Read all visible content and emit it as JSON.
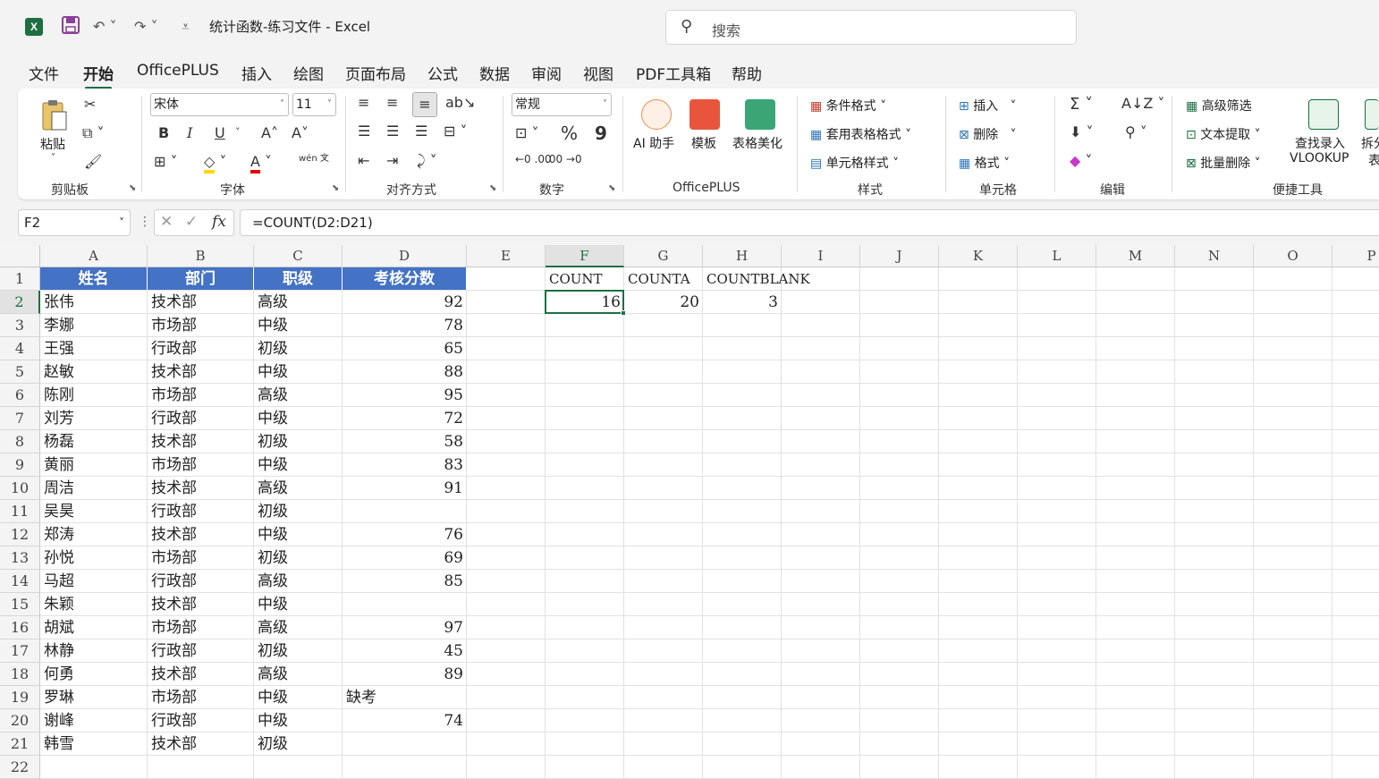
{
  "window": {
    "title": "统计函数-练习文件 - Excel",
    "app_icon": "X"
  },
  "search": {
    "placeholder": "搜索"
  },
  "tabs": [
    "文件",
    "开始",
    "OfficePLUS",
    "插入",
    "绘图",
    "页面布局",
    "公式",
    "数据",
    "审阅",
    "视图",
    "PDF工具箱",
    "帮助"
  ],
  "active_tab": "开始",
  "ribbon": {
    "clipboard": {
      "paste": "粘贴",
      "label": "剪贴板"
    },
    "font": {
      "name": "宋体",
      "size": "11",
      "label": "字体",
      "bold": "B",
      "italic": "I",
      "underline": "U",
      "phonetic": "wén 文"
    },
    "alignment": {
      "label": "对齐方式"
    },
    "number": {
      "format": "常规",
      "label": "数字",
      "percent": "%",
      "comma": "9"
    },
    "officeplus": {
      "ai": "AI 助手",
      "template": "模板",
      "beautify": "表格美化",
      "label": "OfficePLUS"
    },
    "styles": {
      "conditional": "条件格式",
      "table_format": "套用表格格式",
      "cell_styles": "单元格样式",
      "label": "样式"
    },
    "cells": {
      "insert": "插入",
      "delete": "删除",
      "format": "格式",
      "label": "单元格"
    },
    "editing": {
      "label": "编辑"
    },
    "tools": {
      "adv_filter": "高级筛选",
      "text_extract": "文本提取",
      "batch_delete": "批量删除",
      "lookup_line1": "查找录入",
      "lookup_line2": "VLOOKUP",
      "split_line1": "拆分",
      "split_line2": "表",
      "label": "便捷工具"
    }
  },
  "formula_bar": {
    "name_box": "F2",
    "formula": "=COUNT(D2:D21)",
    "fx": "fx"
  },
  "columns": [
    "A",
    "B",
    "C",
    "D",
    "E",
    "F",
    "G",
    "H",
    "I",
    "J",
    "K",
    "L",
    "M",
    "N",
    "O",
    "P"
  ],
  "rows": [
    "1",
    "2",
    "3",
    "4",
    "5",
    "6",
    "7",
    "8",
    "9",
    "10",
    "11",
    "12",
    "13",
    "14",
    "15",
    "16",
    "17",
    "18",
    "19",
    "20",
    "21",
    "22"
  ],
  "selected_cell": "F2",
  "sheet": {
    "header": [
      "姓名",
      "部门",
      "职级",
      "考核分数"
    ],
    "records": [
      [
        "张伟",
        "技术部",
        "高级",
        "92"
      ],
      [
        "李娜",
        "市场部",
        "中级",
        "78"
      ],
      [
        "王强",
        "行政部",
        "初级",
        "65"
      ],
      [
        "赵敏",
        "技术部",
        "中级",
        "88"
      ],
      [
        "陈刚",
        "市场部",
        "高级",
        "95"
      ],
      [
        "刘芳",
        "行政部",
        "中级",
        "72"
      ],
      [
        "杨磊",
        "技术部",
        "初级",
        "58"
      ],
      [
        "黄丽",
        "市场部",
        "中级",
        "83"
      ],
      [
        "周洁",
        "技术部",
        "高级",
        "91"
      ],
      [
        "吴昊",
        "行政部",
        "初级",
        ""
      ],
      [
        "郑涛",
        "技术部",
        "中级",
        "76"
      ],
      [
        "孙悦",
        "市场部",
        "初级",
        "69"
      ],
      [
        "马超",
        "行政部",
        "高级",
        "85"
      ],
      [
        "朱颖",
        "技术部",
        "中级",
        ""
      ],
      [
        "胡斌",
        "市场部",
        "高级",
        "97"
      ],
      [
        "林静",
        "行政部",
        "初级",
        "45"
      ],
      [
        "何勇",
        "技术部",
        "高级",
        "89"
      ],
      [
        "罗琳",
        "市场部",
        "中级",
        "缺考"
      ],
      [
        "谢峰",
        "行政部",
        "中级",
        "74"
      ],
      [
        "韩雪",
        "技术部",
        "初级",
        ""
      ]
    ],
    "stats_labels": [
      "COUNT",
      "COUNTA",
      "COUNTBLANK"
    ],
    "stats_values": [
      "16",
      "20",
      "3"
    ]
  }
}
